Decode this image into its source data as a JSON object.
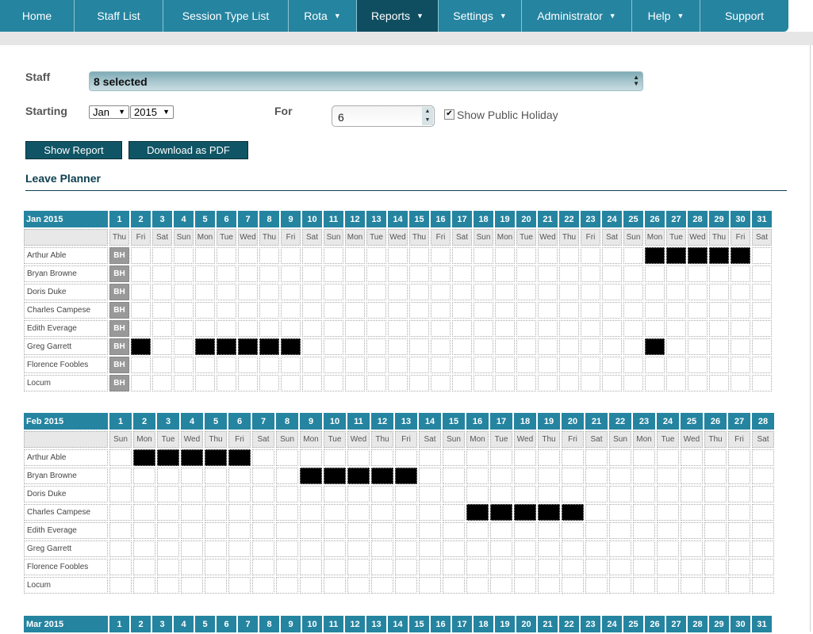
{
  "nav": [
    {
      "label": "Home",
      "dropdown": false,
      "active": false,
      "w": 94
    },
    {
      "label": "Staff List",
      "dropdown": false,
      "active": false,
      "w": 112
    },
    {
      "label": "Session Type List",
      "dropdown": false,
      "active": false,
      "w": 158
    },
    {
      "label": "Rota",
      "dropdown": true,
      "active": false,
      "w": 86
    },
    {
      "label": "Reports",
      "dropdown": true,
      "active": true,
      "w": 103
    },
    {
      "label": "Settings",
      "dropdown": true,
      "active": false,
      "w": 105
    },
    {
      "label": "Administrator",
      "dropdown": true,
      "active": false,
      "w": 139
    },
    {
      "label": "Help",
      "dropdown": true,
      "active": false,
      "w": 86
    },
    {
      "label": "Support",
      "dropdown": false,
      "active": false,
      "w": 111
    }
  ],
  "filters": {
    "staff_label": "Staff",
    "staff_value": "8 selected",
    "starting_label": "Starting",
    "month": "Jan",
    "year": "2015",
    "for_label": "For",
    "for_value": "6",
    "show_public_holiday_label": "Show Public Holiday",
    "show_public_holiday_checked": true
  },
  "buttons": {
    "show_report": "Show Report",
    "download_pdf": "Download as PDF"
  },
  "section_title": "Leave Planner",
  "bh_label": "BH",
  "months": [
    {
      "title": "Jan 2015",
      "days": 31,
      "dow": [
        "Thu",
        "Fri",
        "Sat",
        "Sun",
        "Mon",
        "Tue",
        "Wed",
        "Thu",
        "Fri",
        "Sat",
        "Sun",
        "Mon",
        "Tue",
        "Wed",
        "Thu",
        "Fri",
        "Sat",
        "Sun",
        "Mon",
        "Tue",
        "Wed",
        "Thu",
        "Fri",
        "Sat",
        "Sun",
        "Mon",
        "Tue",
        "Wed",
        "Thu",
        "Fri",
        "Sat"
      ],
      "bank_holidays": [
        1
      ],
      "staff": [
        {
          "name": "Arthur Able",
          "leave": [
            26,
            27,
            28,
            29,
            30
          ]
        },
        {
          "name": "Bryan Browne",
          "leave": []
        },
        {
          "name": "Doris Duke",
          "leave": []
        },
        {
          "name": "Charles Campese",
          "leave": []
        },
        {
          "name": "Edith Everage",
          "leave": []
        },
        {
          "name": "Greg Garrett",
          "leave": [
            2,
            5,
            6,
            7,
            8,
            9,
            26
          ]
        },
        {
          "name": "Florence Foobles",
          "leave": []
        },
        {
          "name": "Locum",
          "leave": []
        }
      ]
    },
    {
      "title": "Feb 2015",
      "days": 28,
      "dow": [
        "Sun",
        "Mon",
        "Tue",
        "Wed",
        "Thu",
        "Fri",
        "Sat",
        "Sun",
        "Mon",
        "Tue",
        "Wed",
        "Thu",
        "Fri",
        "Sat",
        "Sun",
        "Mon",
        "Tue",
        "Wed",
        "Thu",
        "Fri",
        "Sat",
        "Sun",
        "Mon",
        "Tue",
        "Wed",
        "Thu",
        "Fri",
        "Sat"
      ],
      "bank_holidays": [],
      "staff": [
        {
          "name": "Arthur Able",
          "leave": [
            2,
            3,
            4,
            5,
            6
          ]
        },
        {
          "name": "Bryan Browne",
          "leave": [
            9,
            10,
            11,
            12,
            13
          ]
        },
        {
          "name": "Doris Duke",
          "leave": []
        },
        {
          "name": "Charles Campese",
          "leave": [
            16,
            17,
            18,
            19,
            20
          ]
        },
        {
          "name": "Edith Everage",
          "leave": []
        },
        {
          "name": "Greg Garrett",
          "leave": []
        },
        {
          "name": "Florence Foobles",
          "leave": []
        },
        {
          "name": "Locum",
          "leave": []
        }
      ]
    },
    {
      "title": "Mar 2015",
      "days": 31,
      "dow": [],
      "bank_holidays": [],
      "staff": []
    }
  ]
}
